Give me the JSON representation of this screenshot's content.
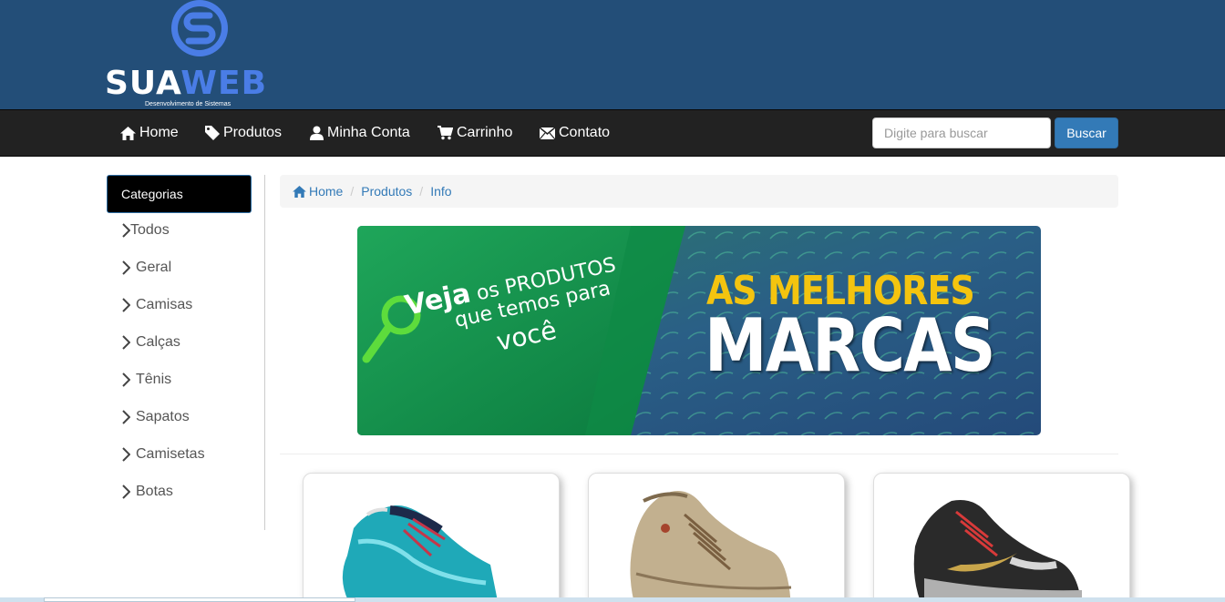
{
  "brand": {
    "name_part1": "SUA",
    "name_part2": "WEB",
    "tagline": "Desenvolvimento de Sistemas",
    "colors": {
      "header": "#234e78",
      "accent": "#4a7de6"
    }
  },
  "navbar": {
    "items": [
      {
        "label": "Home",
        "icon": "home-icon"
      },
      {
        "label": "Produtos",
        "icon": "tag-icon"
      },
      {
        "label": "Minha Conta",
        "icon": "user-icon"
      },
      {
        "label": "Carrinho",
        "icon": "cart-icon"
      },
      {
        "label": "Contato",
        "icon": "envelope-icon"
      }
    ],
    "search_placeholder": "Digite para buscar",
    "search_button": "Buscar"
  },
  "sidebar": {
    "title": "Categorias",
    "items": [
      "Todos",
      "Geral",
      "Camisas",
      "Calças",
      "Tênis",
      "Sapatos",
      "Camisetas",
      "Botas"
    ]
  },
  "breadcrumb": [
    "Home",
    "Produtos",
    "Info"
  ],
  "banner": {
    "line1_big": "Veja",
    "line1_rest": "os PRODUTOS",
    "line2": "que temos para",
    "line3": "você",
    "headline_top": "AS MELHORES",
    "headline_bottom": "MARCAS"
  },
  "products": [
    {
      "image": "running-shoe-teal"
    },
    {
      "image": "casual-sneaker-beige"
    },
    {
      "image": "running-shoe-black-gold"
    }
  ]
}
